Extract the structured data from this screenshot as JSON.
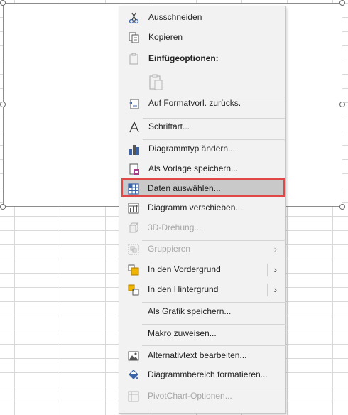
{
  "menu": {
    "cut": "Ausschneiden",
    "copy": "Kopieren",
    "paste_options": "Einfügeoptionen:",
    "reset_style": "Auf Formatvorl. zurücks.",
    "font": "Schriftart...",
    "change_chart_type": "Diagrammtyp ändern...",
    "save_as_template": "Als Vorlage speichern...",
    "select_data": "Daten auswählen...",
    "move_chart": "Diagramm verschieben...",
    "rotation_3d": "3D-Drehung...",
    "group": "Gruppieren",
    "bring_to_front": "In den Vordergrund",
    "send_to_back": "In den Hintergrund",
    "save_as_picture": "Als Grafik speichern...",
    "assign_macro": "Makro zuweisen...",
    "edit_alt_text": "Alternativtext bearbeiten...",
    "format_chart_area": "Diagrammbereich formatieren...",
    "pivotchart_options": "PivotChart-Optionen..."
  },
  "icons": {
    "cut": "scissors-icon",
    "copy": "copy-icon",
    "paste": "clipboard-icon",
    "reset": "reset-style-icon",
    "font": "font-icon",
    "chart_type": "bar-chart-icon",
    "template": "template-icon",
    "select_data": "data-grid-icon",
    "move_chart": "move-chart-icon",
    "rotation": "3d-cube-icon",
    "group": "group-icon",
    "front": "bring-front-icon",
    "back": "send-back-icon",
    "alt_text": "alt-text-icon",
    "format": "paint-bucket-icon",
    "pivot": "pivot-icon"
  },
  "colors": {
    "highlight_border": "#e04848",
    "menu_bg": "#f2f2f2"
  }
}
